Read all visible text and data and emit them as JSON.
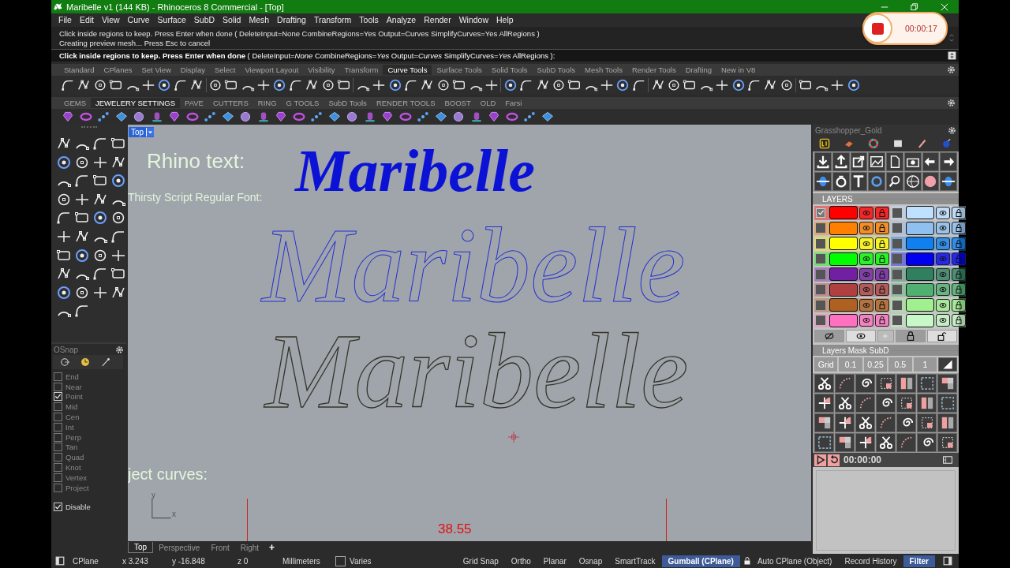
{
  "window": {
    "title": "Maribelle v1 (144 KB) - Rhinoceros 8 Commercial - [Top]"
  },
  "recorder": {
    "time": "00:00:17"
  },
  "menu": [
    "File",
    "Edit",
    "View",
    "Curve",
    "Surface",
    "SubD",
    "Solid",
    "Mesh",
    "Drafting",
    "Transform",
    "Tools",
    "Analyze",
    "Render",
    "Window",
    "Help"
  ],
  "command_history": [
    "Click inside regions to keep. Press Enter when done ( DeleteInput=None  CombineRegions=Yes  Output=Curves  SimplifyCurves=Yes  AllRegions )",
    "Creating preview mesh... Press Esc to cancel"
  ],
  "command_prompt": "**Click inside regions to keep. Press Enter when done** ( DeleteInput=*None*  CombineRegions=*Yes*  Output=*Curves*  SimplifyCurves=*Yes*  AllRegions ):",
  "toolbar_tabs": [
    {
      "label": "Standard",
      "selected": false
    },
    {
      "label": "CPlanes",
      "selected": false
    },
    {
      "label": "Set View",
      "selected": false
    },
    {
      "label": "Display",
      "selected": false
    },
    {
      "label": "Select",
      "selected": false
    },
    {
      "label": "Viewport Layout",
      "selected": false
    },
    {
      "label": "Visibility",
      "selected": false
    },
    {
      "label": "Transform",
      "selected": false
    },
    {
      "label": "Curve Tools",
      "selected": true
    },
    {
      "label": "Surface Tools",
      "selected": false
    },
    {
      "label": "Solid Tools",
      "selected": false
    },
    {
      "label": "SubD Tools",
      "selected": false
    },
    {
      "label": "Mesh Tools",
      "selected": false
    },
    {
      "label": "Render Tools",
      "selected": false
    },
    {
      "label": "Drafting",
      "selected": false
    },
    {
      "label": "New in V8",
      "selected": false
    }
  ],
  "jewelry_tabs": [
    {
      "label": "GEMS",
      "selected": false
    },
    {
      "label": "JEWELERY SETTINGS",
      "selected": true
    },
    {
      "label": "PAVE",
      "selected": false
    },
    {
      "label": "CUTTERS",
      "selected": false
    },
    {
      "label": "RING",
      "selected": false
    },
    {
      "label": "G TOOLS",
      "selected": false
    },
    {
      "label": "SubD Tools",
      "selected": false
    },
    {
      "label": "RENDER TOOLS",
      "selected": false
    },
    {
      "label": "BOOST",
      "selected": false
    },
    {
      "label": "OLD",
      "selected": false
    },
    {
      "label": "Farsi",
      "selected": false
    }
  ],
  "viewport": {
    "label": "Top",
    "heading": "Rhino text:",
    "font_note": "Thirsty Script Regular Font:",
    "sample": "Maribelle",
    "outline_upper": "Maribelle",
    "outline_lower": "Maribelle",
    "caption": "ject curves:",
    "axis_y": "y",
    "axis_x": "x",
    "dimension": "38.55"
  },
  "viewport_tabs": [
    {
      "label": "Top",
      "selected": true
    },
    {
      "label": "Perspective",
      "selected": false
    },
    {
      "label": "Front",
      "selected": false
    },
    {
      "label": "Right",
      "selected": false
    }
  ],
  "add_tab": "+",
  "osnap": {
    "title": "OSnap",
    "options": [
      {
        "label": "End",
        "checked": false
      },
      {
        "label": "Near",
        "checked": false
      },
      {
        "label": "Point",
        "checked": true
      },
      {
        "label": "Mid",
        "checked": false
      },
      {
        "label": "Cen",
        "checked": false
      },
      {
        "label": "Int",
        "checked": false
      },
      {
        "label": "Perp",
        "checked": false
      },
      {
        "label": "Tan",
        "checked": false
      },
      {
        "label": "Quad",
        "checked": false
      },
      {
        "label": "Knot",
        "checked": false
      },
      {
        "label": "Vertex",
        "checked": false
      },
      {
        "label": "Project",
        "checked": false
      }
    ],
    "disable": {
      "label": "Disable",
      "checked": true
    }
  },
  "panel": {
    "title": "Grasshopper_Gold",
    "layers_header": "LAYERS",
    "layers": [
      {
        "color": "#ff0000",
        "checked": true
      },
      {
        "color": "#c0e0ff",
        "checked": false
      },
      {
        "color": "#ff8000",
        "checked": false
      },
      {
        "color": "#90c0f0",
        "checked": false
      },
      {
        "color": "#ffff00",
        "checked": false
      },
      {
        "color": "#1080f0",
        "checked": false
      },
      {
        "color": "#00ff00",
        "checked": false
      },
      {
        "color": "#0000f0",
        "checked": false
      },
      {
        "color": "#7020a0",
        "checked": false
      },
      {
        "color": "#308060",
        "checked": false
      },
      {
        "color": "#b04040",
        "checked": false
      },
      {
        "color": "#50b070",
        "checked": false
      },
      {
        "color": "#b06020",
        "checked": false
      },
      {
        "color": "#a0f090",
        "checked": false
      },
      {
        "color": "#ff70c0",
        "checked": false
      },
      {
        "color": "#c8f8c8",
        "checked": false
      }
    ],
    "mask_header": "Layers Mask SubD",
    "grid_buttons": [
      "Grid",
      "0.1",
      "0.25",
      "0.5",
      "1"
    ],
    "timer": "00:00:00"
  },
  "status_bar": {
    "cplane": "CPlane",
    "x": "x 3.243",
    "y": "y -16.848",
    "z": "z 0",
    "units": "Millimeters",
    "layer": "Varies",
    "toggles": [
      {
        "kind": "toggle",
        "label": "Grid Snap",
        "on": false
      },
      {
        "kind": "toggle",
        "label": "Ortho",
        "on": false
      },
      {
        "kind": "toggle",
        "label": "Planar",
        "on": false
      },
      {
        "kind": "toggle",
        "label": "Osnap",
        "on": false
      },
      {
        "kind": "toggle",
        "label": "SmartTrack",
        "on": false
      },
      {
        "kind": "toggle",
        "label": "Gumball (CPlane)",
        "on": true
      },
      {
        "kind": "locked",
        "label": "Auto CPlane (Object)",
        "on": false
      },
      {
        "kind": "toggle",
        "label": "Record History",
        "on": false
      },
      {
        "kind": "toggle",
        "label": "Filter",
        "on": true
      }
    ]
  }
}
